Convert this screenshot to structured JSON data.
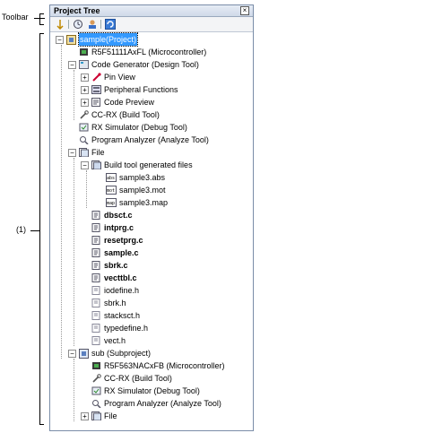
{
  "callouts": {
    "toolbar": "Toolbar",
    "item_one": "(1)"
  },
  "panel": {
    "title": "Project Tree",
    "close_glyph": "×"
  },
  "toolbar": {
    "buttons": [
      "expand-collapse-icon",
      "properties-icon",
      "user-icon",
      "refresh-icon"
    ]
  },
  "tree": {
    "project": "sample(Project)",
    "microcontroller": "R5F51111AxFL (Microcontroller)",
    "code_generator": "Code Generator (Design Tool)",
    "pin_view": "Pin View",
    "peripheral_functions": "Peripheral Functions",
    "code_preview": "Code Preview",
    "build_tool": "CC-RX (Build Tool)",
    "debug_tool": "RX Simulator (Debug Tool)",
    "analyze_tool": "Program Analyzer (Analyze Tool)",
    "file": "File",
    "build_generated": "Build tool generated files",
    "gen_files": [
      "sample3.abs",
      "sample3.mot",
      "sample3.map"
    ],
    "gen_icon_text": [
      "abs",
      "mot",
      "map"
    ],
    "source_files": [
      "dbsct.c",
      "intprg.c",
      "resetprg.c",
      "sample.c",
      "sbrk.c",
      "vecttbl.c"
    ],
    "header_files": [
      "iodefine.h",
      "sbrk.h",
      "stacksct.h",
      "typedefine.h",
      "vect.h"
    ],
    "subproject": "sub (Subproject)",
    "sub_microcontroller": "R5F563NACxFB (Microcontroller)",
    "sub_build_tool": "CC-RX (Build Tool)",
    "sub_debug_tool": "RX Simulator (Debug Tool)",
    "sub_analyze_tool": "Program Analyzer (Analyze Tool)",
    "sub_file": "File",
    "expand_minus": "−",
    "expand_plus": "+"
  }
}
